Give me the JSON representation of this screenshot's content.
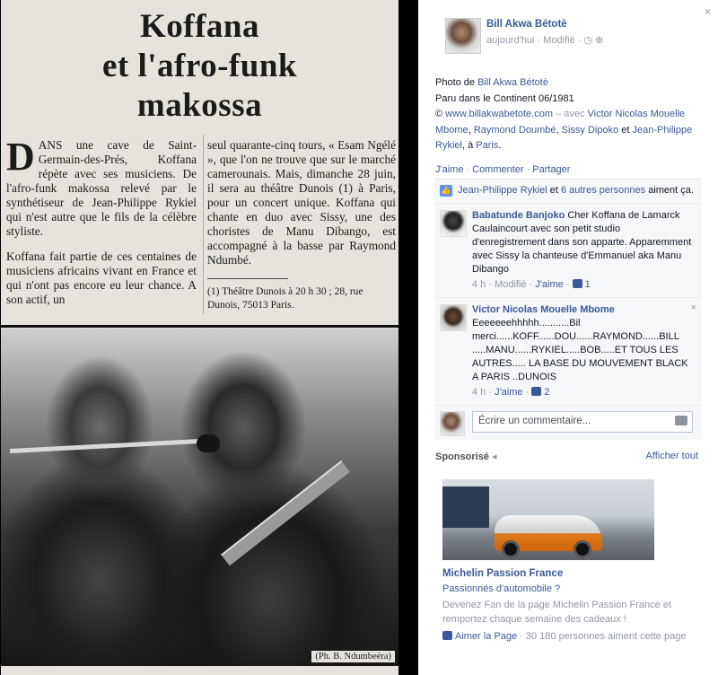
{
  "article": {
    "headline_line1": "Koffana",
    "headline_line2": "et l'afro-funk",
    "headline_line3": "makossa",
    "dropcap": "D",
    "col1_par1": "ANS une cave de Saint-Germain-des-Prés, Koffana répète avec ses musiciens. De l'afro-funk makossa relevé par le synthétiseur de Jean-Philippe Rykiel qui n'est autre que le fils de la célèbre styliste.",
    "col1_par2": "Koffana fait partie de ces centaines de musiciens africains vivant en France et qui n'ont pas encore eu leur chance. A son actif, un",
    "col2_text": "seul quarante-cinq tours, « Esam Ngélé », que l'on ne trouve que sur le marché camerounais. Mais, dimanche 28 juin, il sera au théâtre Dunois (1) à Paris, pour un concert unique. Koffana qui chante en duo avec Sissy, une des choristes de Manu Dibango, est accompagné à la basse par Raymond Ndumbé.",
    "footnote": "(1) Théâtre Dunois à 20 h 30 ; 28, rue Dunois, 75013 Paris.",
    "photo_credit": "(Ph. B. Ndumbeéra)"
  },
  "sidebar": {
    "close_glyph": "×",
    "owner_name": "Bill Akwa Bétotè",
    "owner_meta": "aujourd'hui · Modifié · ◷ ⊕",
    "caption": {
      "photo_de": "Photo de ",
      "photo_author": "Bill Akwa Bétotè",
      "line2": "Paru dans le Continent 06/1981",
      "copyright": "© ",
      "website": "www.billakwabetote.com",
      "avec": " – avec ",
      "tagged": [
        "Victor Nicolas Mouelle Mbome",
        "Raymond Doumbé",
        "Sissy Dipoko",
        "Jean-Philippe Rykiel"
      ],
      "sep1": ", ",
      "sep2": ", ",
      "sep3": " et ",
      "a": ", à ",
      "place": "Paris",
      "end": "."
    },
    "actions": {
      "like": "J'aime",
      "comment": "Commenter",
      "share": "Partager",
      "dot": "·"
    },
    "likes": {
      "name": "Jean-Philippe Rykiel",
      "et": " et ",
      "others": "6 autres personnes",
      "tail": " aiment ça."
    },
    "comments": [
      {
        "author": "Babatunde Banjoko",
        "text": " Cher Koffana de Lamarck Caulaincourt avec son petit studio d'enregistrement dans son apparte. Apparemment avec Sissy la chanteuse d'Emmanuel aka Manu Dibango",
        "time": "4 h",
        "edited": "Modifié",
        "like": "J'aime",
        "like_count": "1",
        "dot": " · "
      },
      {
        "author": "Victor Nicolas Mouelle Mbome",
        "text": "Eeeeeeehhhhh...........Bil merci......KOFF......DOU......RAYMOND......BILL .....MANU......RYKIEL.....BOB.....ET TOUS LES AUTRES..... LA BASE DU MOUVEMENT BLACK A PARIS ..DUNOIS",
        "time": "4 h",
        "like": "J'aime",
        "like_count": "2",
        "dot": " · ",
        "close_glyph": "×"
      }
    ],
    "compose_placeholder": "Écrire un commentaire...",
    "sponsored": {
      "label": "Sponsorisé",
      "see_all": "Afficher tout",
      "ad_title": "Michelin Passion France",
      "ad_subtitle": "Passionnés d'automobile ?",
      "ad_body": "Devenez Fan de la page Michelin Passion France et remportez chaque semaine des cadeaux !",
      "like_page": "Aimer la Page",
      "like_count_text": " · 30 180 personnes aiment cette page"
    }
  }
}
